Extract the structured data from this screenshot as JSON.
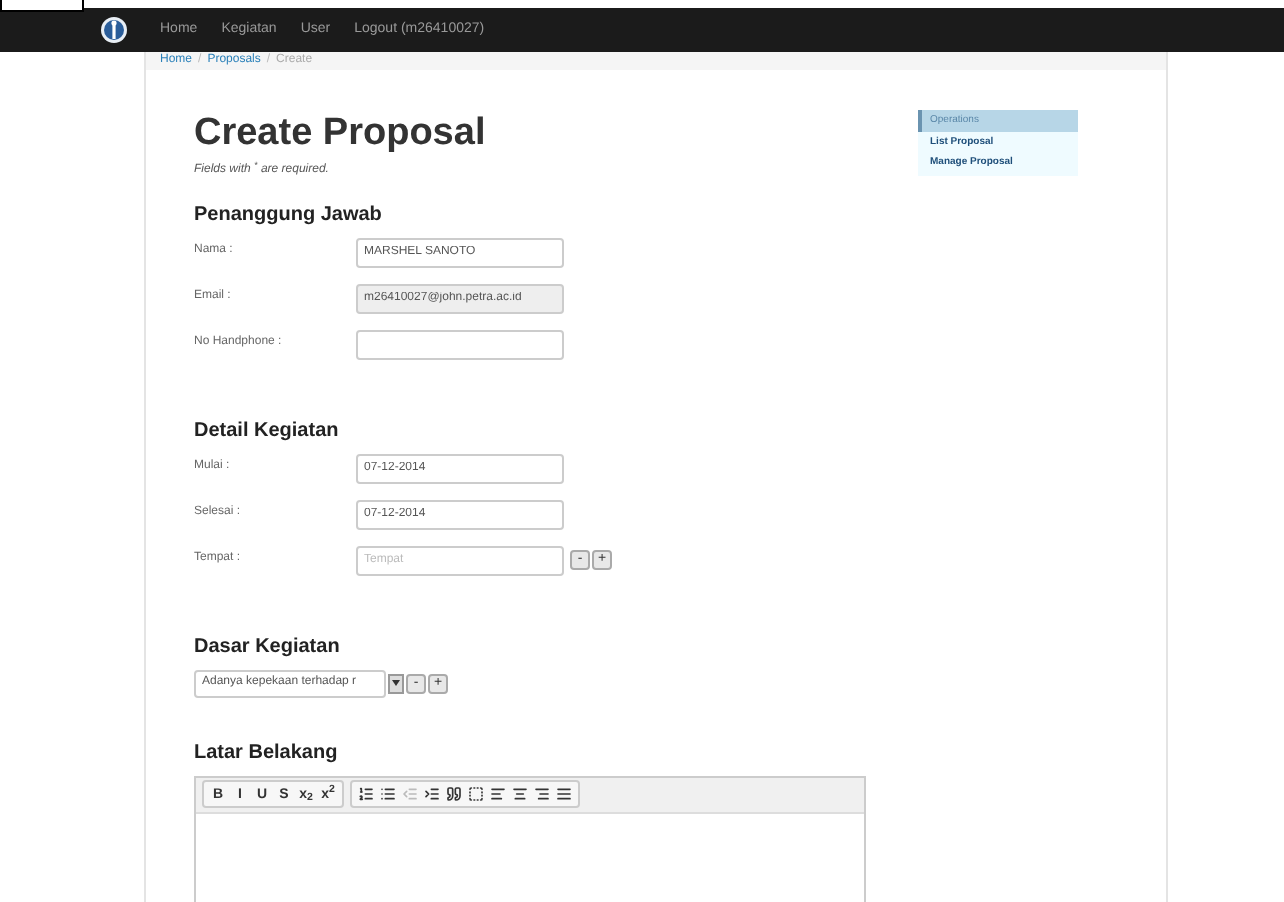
{
  "nav": {
    "items": [
      "Home",
      "Kegiatan",
      "User",
      "Logout (m26410027)"
    ]
  },
  "breadcrumb": {
    "links": [
      "Home",
      "Proposals"
    ],
    "separator": "/",
    "current": "Create"
  },
  "title": "Create Proposal",
  "note": "Fields with $^{*}$ are required.",
  "sections": [
    {
      "heading": "Penanggung Jawab",
      "fields": [
        {
          "label": "Nama :",
          "value": "MARSHEL SANOTO",
          "disabled": false
        },
        {
          "label": "Email :",
          "value": "m26410027@john.petra.ac.id",
          "disabled": true
        },
        {
          "label": "No Handphone :",
          "disabled": false
        }
      ]
    },
    {
      "heading": "Detail Kegiatan",
      "fields": [
        {
          "label": "Mulai :",
          "value": "07-12-2014",
          "disabled": false
        },
        {
          "label": "Selesai :",
          "value": "07-12-2014",
          "disabled": false
        },
        {
          "label": "Tempat :",
          "placeholder": "Tempat",
          "disabled": false,
          "buttons": [
            "-",
            "+"
          ]
        }
      ]
    }
  ],
  "dasar": {
    "heading": "Dasar Kegiatan",
    "select": "Adanya kepekaan terhadap r",
    "buttons": [
      "-",
      "+"
    ]
  },
  "latar": {
    "heading": "Latar Belakang",
    "toolbar": [
      [
        {
          "kind": "text",
          "label": "B",
          "disabled": false
        },
        {
          "kind": "text",
          "label": "I",
          "disabled": false
        },
        {
          "kind": "text",
          "label": "U",
          "disabled": false
        },
        {
          "kind": "text",
          "label": "S",
          "disabled": false
        },
        {
          "kind": "text",
          "label": "x$_{2}$",
          "disabled": false
        },
        {
          "kind": "text",
          "label": "x$^{2}$",
          "disabled": false
        }
      ],
      [
        {
          "kind": "ordered",
          "disabled": false
        },
        {
          "kind": "bullets",
          "disabled": false
        },
        {
          "kind": "outdent",
          "disabled": true
        },
        {
          "kind": "indent",
          "disabled": false
        },
        {
          "kind": "quote",
          "disabled": false
        },
        {
          "kind": "block",
          "disabled": false
        },
        {
          "kind": "left",
          "disabled": false
        },
        {
          "kind": "center",
          "disabled": false
        },
        {
          "kind": "right",
          "disabled": false
        },
        {
          "kind": "justify",
          "disabled": false
        }
      ]
    ]
  },
  "operations": {
    "title": "Operations",
    "links": [
      "List Proposal",
      "Manage Proposal"
    ]
  }
}
